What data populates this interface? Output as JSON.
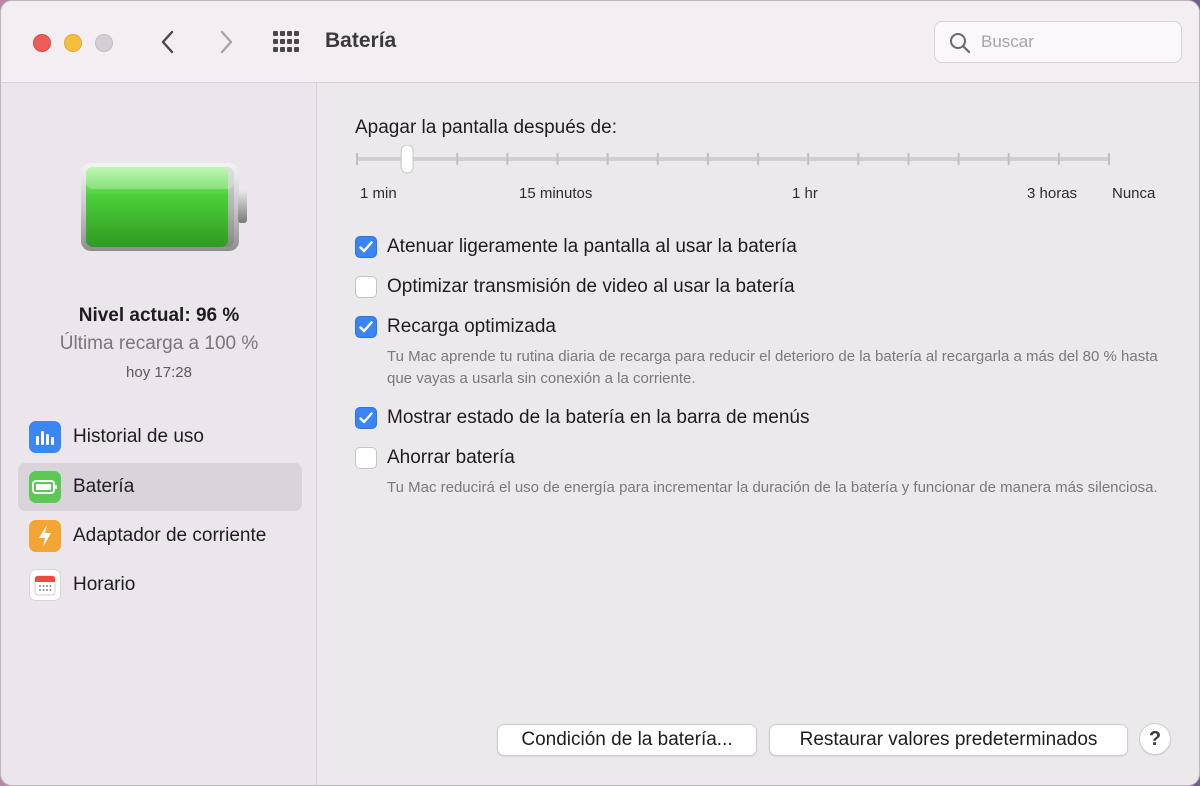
{
  "window": {
    "title": "Batería",
    "search_placeholder": "Buscar"
  },
  "battery": {
    "level_current": "Nivel actual: 96 %",
    "last_charge": "Última recarga a 100 %",
    "last_charge_time": "hoy 17:28",
    "fill_fraction": 0.96
  },
  "sidebar": {
    "items": [
      {
        "label": "Historial de uso",
        "icon": "usage-history-icon",
        "selected": false
      },
      {
        "label": "Batería",
        "icon": "battery-icon",
        "selected": true
      },
      {
        "label": "Adaptador de corriente",
        "icon": "power-adapter-icon",
        "selected": false
      },
      {
        "label": "Horario",
        "icon": "calendar-icon",
        "selected": false
      }
    ]
  },
  "display_sleep": {
    "title": "Apagar la pantalla después de:",
    "tick_labels": [
      "1 min",
      "15 minutos",
      "1 hr",
      "3 horas",
      "Nunca"
    ],
    "tick_count": 16,
    "selected_tick": 1
  },
  "options": [
    {
      "label": "Atenuar ligeramente la pantalla al usar la batería",
      "checked": true,
      "description": ""
    },
    {
      "label": "Optimizar transmisión de video al usar la batería",
      "checked": false,
      "description": ""
    },
    {
      "label": "Recarga optimizada",
      "checked": true,
      "description": "Tu Mac aprende tu rutina diaria de recarga para reducir el deterioro de la batería al recargarla a más del 80 % hasta que vayas a usarla sin conexión a la corriente."
    },
    {
      "label": "Mostrar estado de la batería en la barra de menús",
      "checked": true,
      "description": ""
    },
    {
      "label": "Ahorrar batería",
      "checked": false,
      "description": "Tu Mac reducirá el uso de energía para incrementar la duración de la batería y funcionar de manera más silenciosa."
    }
  ],
  "buttons": {
    "battery_health": "Condición de la batería...",
    "restore_defaults": "Restaurar valores predeterminados",
    "help": "?"
  },
  "colors": {
    "accent": "#3a84f6",
    "battery_green": "#4cd13a",
    "traffic_red": "#ee5d57",
    "traffic_yellow": "#f5bf3a"
  }
}
